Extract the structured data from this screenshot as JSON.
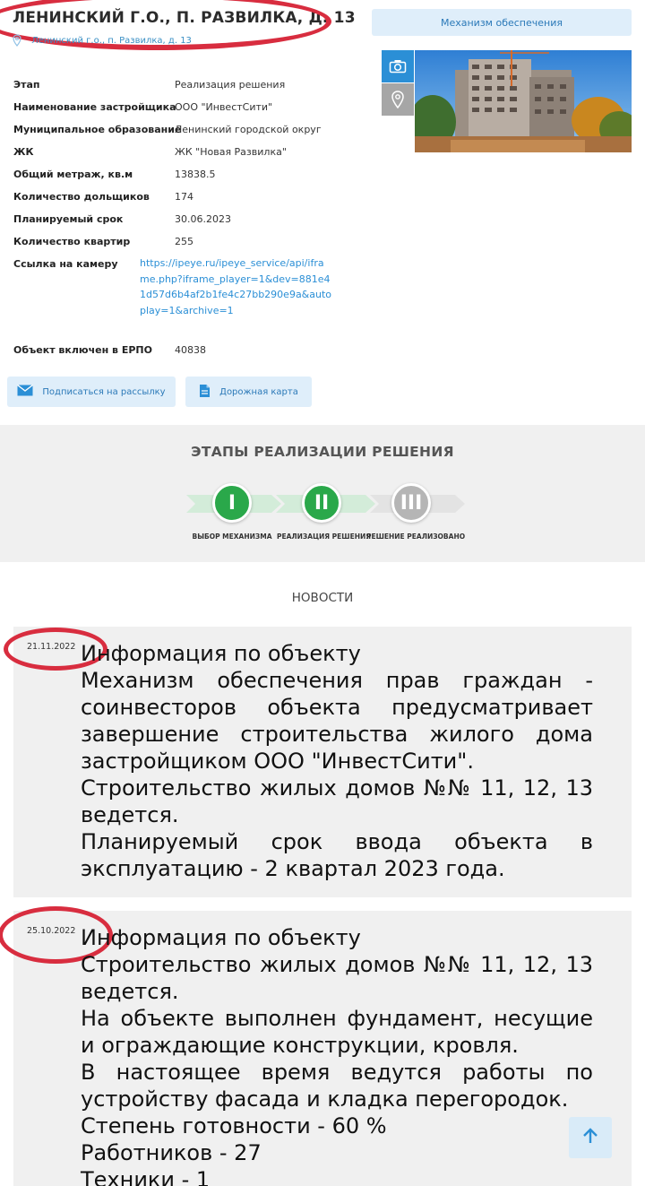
{
  "header": {
    "title": "ЛЕНИНСКИЙ Г.О., П. РАЗВИЛКА, Д. 13",
    "address": "Ленинский г.о., п. Развилка, д. 13",
    "mechanism_button": "Механизм обеспечения"
  },
  "media": {
    "camera_icon": "camera-icon",
    "map_icon": "map-pin-icon"
  },
  "info": {
    "rows": [
      {
        "label": "Этап",
        "value": "Реализация решения"
      },
      {
        "label": "Наименование застройщика",
        "value": "ООО \"ИнвестСити\""
      },
      {
        "label": "Муниципальное образование",
        "value": "Ленинский городской округ"
      },
      {
        "label": "ЖК",
        "value": "ЖК \"Новая Развилка\""
      },
      {
        "label": "Общий метраж, кв.м",
        "value": "13838.5"
      },
      {
        "label": "Количество дольщиков",
        "value": "174"
      },
      {
        "label": "Планируемый срок",
        "value": "30.06.2023"
      },
      {
        "label": "Количество квартир",
        "value": "255"
      }
    ],
    "camera_label": "Ссылка на камеру",
    "camera_link": "https://ipeye.ru/ipeye_service/api/iframe.php?iframe_player=1&dev=881e41d57d6b4af2b1fe4c27bb290e9a&autoplay=1&archive=1",
    "erpo_label": "Объект включен в ЕРПО",
    "erpo_value": "40838"
  },
  "actions": {
    "subscribe": "Подписаться на рассылку",
    "roadmap": "Дорожная карта"
  },
  "stages": {
    "title": "ЭТАПЫ РЕАЛИЗАЦИИ РЕШЕНИЯ",
    "items": [
      {
        "numeral": "I",
        "label": "ВЫБОР МЕХАНИЗМА",
        "state": "done",
        "color": "#2aa84a"
      },
      {
        "numeral": "II",
        "label": "РЕАЛИЗАЦИЯ РЕШЕНИЯ",
        "state": "current",
        "color": "#2aa84a"
      },
      {
        "numeral": "III",
        "label": "РЕШЕНИЕ РЕАЛИЗОВАНО",
        "state": "pending",
        "color": "#b5b5b5"
      }
    ]
  },
  "news": {
    "heading": "НОВОСТИ",
    "items": [
      {
        "date": "21.11.2022",
        "title": "Информация по объекту",
        "paragraphs": [
          "Механизм обеспечения прав граждан - соинвесторов объекта предусматривает завершение строительства жилого дома застройщиком ООО \"ИнвестСити\".",
          "Строительство жилых домов №№ 11, 12, 13 ведется.",
          "Планируемый срок ввода объекта в эксплуатацию - 2 квартал 2023 года."
        ]
      },
      {
        "date": "25.10.2022",
        "title": "Информация по объекту",
        "paragraphs": [
          "Строительство жилых домов №№ 11, 12, 13 ведется.",
          "На объекте выполнен фундамент, несущие и ограждающие конструкции, кровля.",
          "В настоящее время ведутся работы по устройству фасада и кладка перегородок.",
          "Степень готовности - 60 %",
          "Работников - 27",
          "Техники - 1"
        ]
      }
    ]
  },
  "colors": {
    "accent": "#2b8fd6",
    "button_bg": "#dfeefa",
    "annotation_red": "#d82d3f",
    "stage_green": "#2aa84a",
    "stage_grey": "#b5b5b5"
  }
}
